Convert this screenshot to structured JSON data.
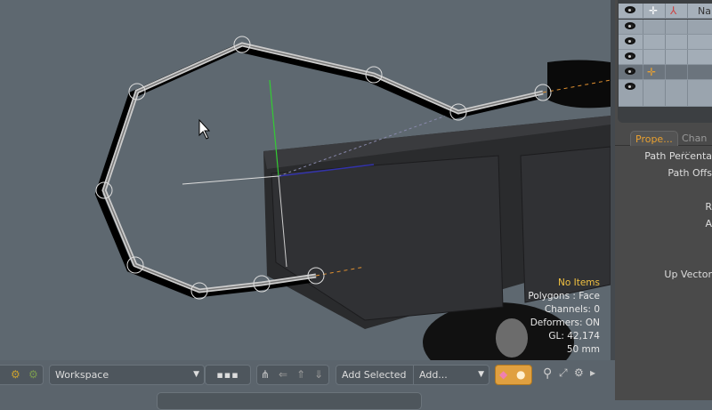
{
  "viewport": {
    "info": {
      "selection": "No Items",
      "mode": "Polygons : Face",
      "channels": "Channels: 0",
      "deformers": "Deformers: ON",
      "gl": "GL: 42,174",
      "scale": "50 mm"
    }
  },
  "item_list": {
    "header_name": "Nam",
    "rows": 5,
    "selected_row": 3
  },
  "properties": {
    "tabs": [
      {
        "label": "Prope..."
      },
      {
        "label": "Chan ..."
      }
    ],
    "fields": [
      "Path Percenta",
      "Path Offs",
      "R",
      "A",
      "Up Vector"
    ]
  },
  "toolbar": {
    "workspace": "Workspace",
    "add_selected": "Add Selected",
    "add_menu": "Add...",
    "accent": "#e0a040"
  }
}
